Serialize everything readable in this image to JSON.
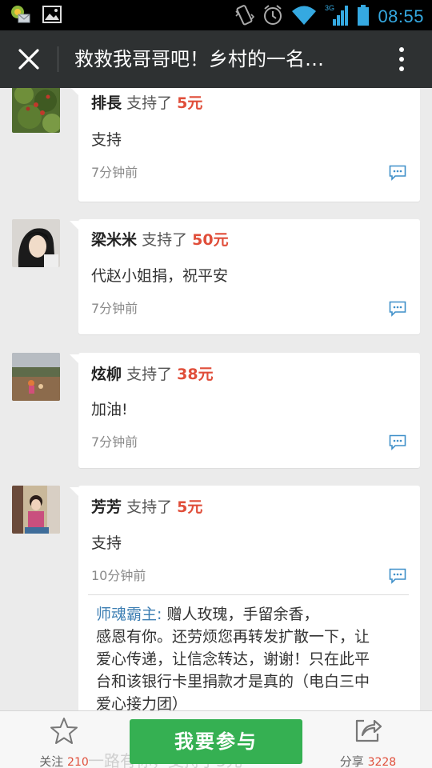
{
  "status_bar": {
    "time": "08:55",
    "network": "3G",
    "icons": [
      "app-notification-icon",
      "gallery-icon",
      "vibrate-icon",
      "alarm-icon",
      "wifi-icon",
      "signal-icon",
      "battery-icon"
    ]
  },
  "title_bar": {
    "title": "救救我哥哥吧！乡村的一名…",
    "icons": [
      "close-icon",
      "more-icon"
    ]
  },
  "feed": {
    "items": [
      {
        "name": "排長",
        "verb": "支持了",
        "amount": "5元",
        "message": "支持",
        "time": "7分钟前"
      },
      {
        "name": "梁米米",
        "verb": "支持了",
        "amount": "50元",
        "message": "代赵小姐捐，祝平安",
        "time": "7分钟前"
      },
      {
        "name": "炫柳",
        "verb": "支持了",
        "amount": "38元",
        "message": "加油!",
        "time": "7分钟前"
      },
      {
        "name": "芳芳",
        "verb": "支持了",
        "amount": "5元",
        "message": "支持",
        "time": "10分钟前",
        "reply": {
          "name": "师魂霸主:",
          "lines": [
            "赠人玫瑰，手留余香，",
            "感恩有你。还劳烦您再转发扩散一下，让",
            "爱心传递，让信念转达，谢谢！只在此平",
            "台和该银行卡里捐款才是真的（电白三中",
            "爱心接力团）"
          ]
        }
      }
    ]
  },
  "bottom_bar": {
    "follow_label": "关注",
    "follow_count": "210",
    "join_label": "我要参与",
    "share_label": "分享",
    "share_count": "3228",
    "ghost_text": "一路有你，支持了5元"
  },
  "colors": {
    "title_bar": "#2e3132",
    "amount": "#e04e3a",
    "join_button": "#35b052",
    "reply_name": "#3e7fb3",
    "time_blue": "#35a9e1"
  }
}
